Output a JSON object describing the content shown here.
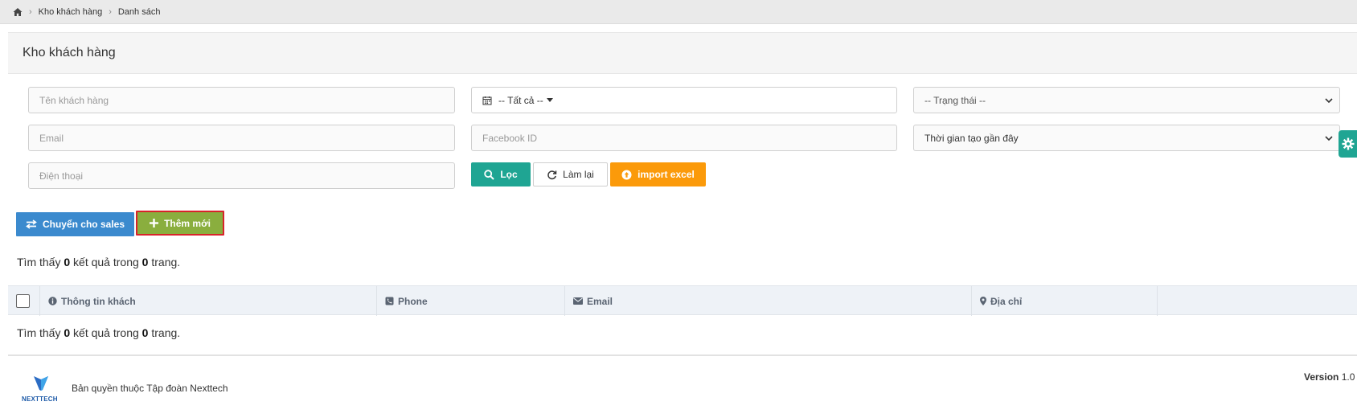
{
  "breadcrumb": {
    "items": [
      "Kho khách hàng",
      "Danh sách"
    ]
  },
  "panel": {
    "title": "Kho khách hàng"
  },
  "filters": {
    "customer_name_placeholder": "Tên khách hàng",
    "date_range_value": "-- Tất cả --",
    "status_value": "-- Trạng thái --",
    "email_placeholder": "Email",
    "facebook_placeholder": "Facebook ID",
    "sort_value": "Thời gian tạo gần đây",
    "phone_placeholder": "Điện thoại"
  },
  "buttons": {
    "filter": "Lọc",
    "reset": "Làm lại",
    "import": "import excel",
    "transfer": "Chuyển cho sales",
    "add": "Thêm mới"
  },
  "results": {
    "prefix": "Tìm thấy",
    "count": "0",
    "middle": "kết quả trong",
    "pages": "0",
    "suffix": "trang."
  },
  "table": {
    "columns": [
      "Thông tin khách",
      "Phone",
      "Email",
      "Địa chỉ"
    ]
  },
  "footer": {
    "logo_text": "NEXTTECH",
    "copyright": "Bản quyền thuộc Tập đoàn Nexttech",
    "version_label": "Version",
    "version_value": "1.0"
  },
  "colors": {
    "primary_teal": "#1fa593",
    "warning_orange": "#fb9a0a",
    "info_blue": "#3b8ace",
    "success_green": "#8aae3e"
  }
}
